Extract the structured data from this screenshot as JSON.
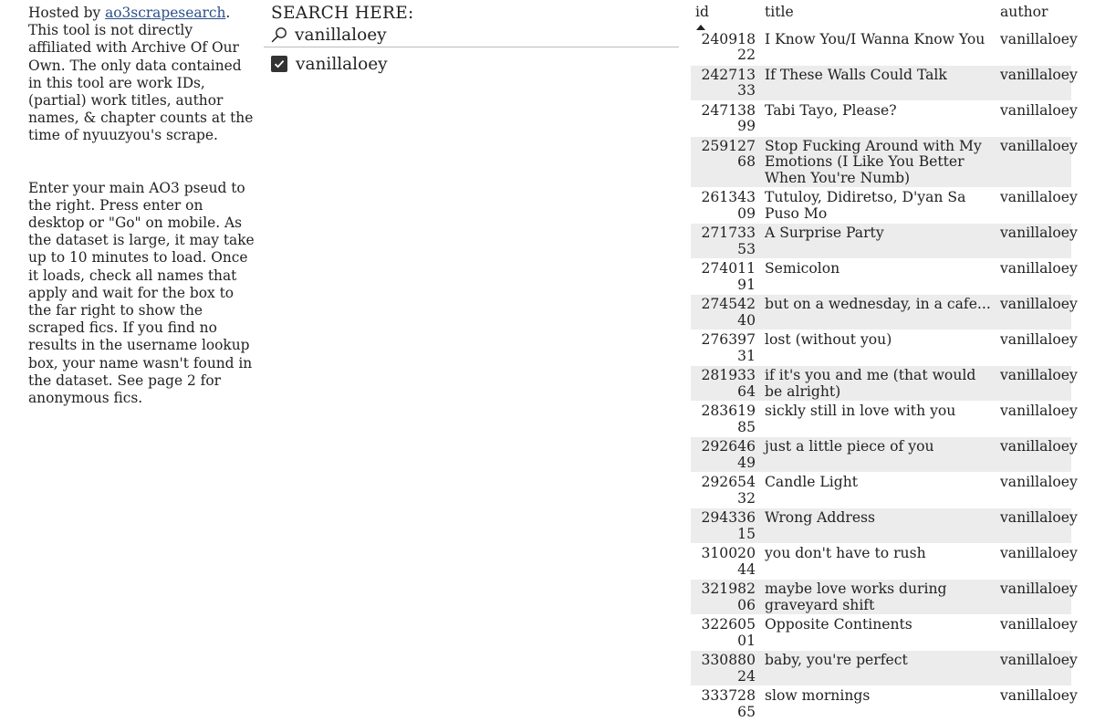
{
  "info": {
    "intro_prefix": "Hosted by ",
    "intro_link": "ao3scrapesearch",
    "intro_suffix": ". This tool is not directly affiliated with Archive Of Our Own. The only data contained in this tool are work IDs, (partial) work titles, author names, & chapter counts at the time of nyuuzyou's scrape.",
    "instructions": "Enter your main AO3 pseud to the right. Press enter on desktop or \"Go\" on mobile. As the dataset is large, it may take up to 10 minutes to load. Once it loads, check all names that apply and wait for the box to the far right to show the scraped fics. If you find no results in the username lookup box, your name wasn't found in the dataset. See page 2 for anonymous fics."
  },
  "search": {
    "heading": "SEARCH HERE:",
    "value": "vanillaloey",
    "icon": "search-icon",
    "options": [
      {
        "label": "vanillaloey",
        "checked": true
      }
    ]
  },
  "table": {
    "columns": [
      "id",
      "title",
      "author"
    ],
    "sort": {
      "column": "id",
      "direction": "ascending"
    },
    "rows": [
      {
        "id": "24091822",
        "title": "I Know You/I Wanna Know You",
        "author": "vanillaloey"
      },
      {
        "id": "24271333",
        "title": "If These Walls Could Talk",
        "author": "vanillaloey"
      },
      {
        "id": "24713899",
        "title": "Tabi Tayo, Please?",
        "author": "vanillaloey"
      },
      {
        "id": "25912768",
        "title": "Stop Fucking Around with My Emotions (I Like You Better When You're Numb)",
        "author": "vanillaloey"
      },
      {
        "id": "26134309",
        "title": "Tutuloy, Didiretso, D'yan Sa Puso Mo",
        "author": "vanillaloey"
      },
      {
        "id": "27173353",
        "title": "A Surprise Party",
        "author": "vanillaloey"
      },
      {
        "id": "27401191",
        "title": "Semicolon",
        "author": "vanillaloey"
      },
      {
        "id": "27454240",
        "title": "but on a wednesday, in a cafe...",
        "author": "vanillaloey"
      },
      {
        "id": "27639731",
        "title": "lost (without you)",
        "author": "vanillaloey"
      },
      {
        "id": "28193364",
        "title": "if it's you and me (that would be alright)",
        "author": "vanillaloey"
      },
      {
        "id": "28361985",
        "title": "sickly still in love with you",
        "author": "vanillaloey"
      },
      {
        "id": "29264649",
        "title": "just a little piece of you",
        "author": "vanillaloey"
      },
      {
        "id": "29265432",
        "title": "Candle Light",
        "author": "vanillaloey"
      },
      {
        "id": "29433615",
        "title": "Wrong Address",
        "author": "vanillaloey"
      },
      {
        "id": "31002044",
        "title": "you don't have to rush",
        "author": "vanillaloey"
      },
      {
        "id": "32198206",
        "title": "maybe love works during graveyard shift",
        "author": "vanillaloey"
      },
      {
        "id": "32260501",
        "title": "Opposite Continents",
        "author": "vanillaloey"
      },
      {
        "id": "33088024",
        "title": "baby, you're perfect",
        "author": "vanillaloey"
      },
      {
        "id": "33372865",
        "title": "slow mornings",
        "author": "vanillaloey"
      }
    ]
  }
}
